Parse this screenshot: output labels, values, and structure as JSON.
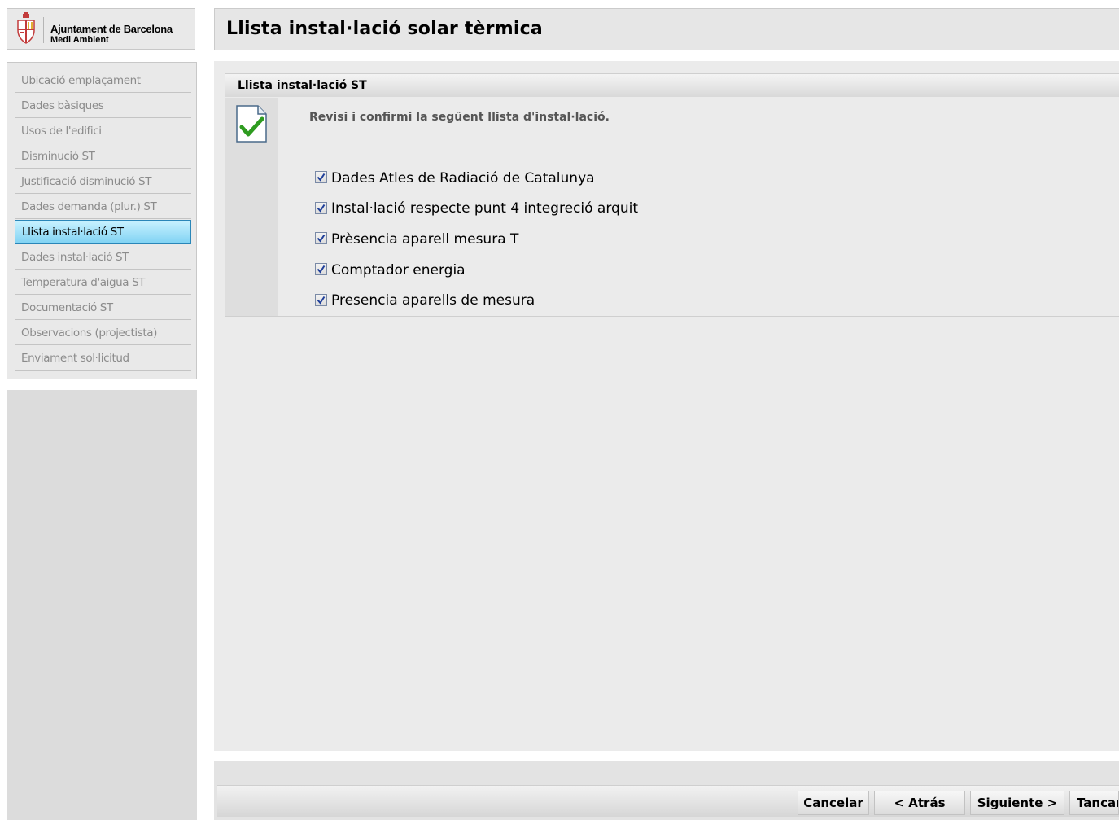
{
  "logo": {
    "title": "Ajuntament de Barcelona",
    "subtitle": "Medi Ambient"
  },
  "page_title": "Llista instal·lació solar tèrmica",
  "nav": [
    {
      "label": "Ubicació emplaçament"
    },
    {
      "label": "Dades bàsiques"
    },
    {
      "label": "Usos de l'edifici"
    },
    {
      "label": "Disminució ST"
    },
    {
      "label": "Justificació disminució ST"
    },
    {
      "label": "Dades demanda (plur.) ST"
    },
    {
      "label": "Llista instal·lació ST"
    },
    {
      "label": "Dades instal·lació ST"
    },
    {
      "label": "Temperatura d'aigua ST"
    },
    {
      "label": "Documentació ST"
    },
    {
      "label": "Observacions (projectista)"
    },
    {
      "label": "Enviament sol·licitud"
    }
  ],
  "active_nav_index": 6,
  "panel": {
    "header": "Llista instal·lació ST",
    "intro": "Revisi i confirmi la següent llista d'instal·lació.",
    "items": [
      {
        "label": "Dades Atles de Radiació de Catalunya",
        "checked": true
      },
      {
        "label": "Instal·lació respecte punt 4 integreció arquit",
        "checked": true
      },
      {
        "label": "Prèsencia aparell mesura T",
        "checked": true
      },
      {
        "label": "Comptador energia",
        "checked": true
      },
      {
        "label": "Presencia aparells de mesura",
        "checked": true
      }
    ]
  },
  "buttons": {
    "cancel": "Cancelar",
    "back": "< Atrás",
    "next": "Siguiente >",
    "close": "Tancar"
  },
  "icons": {
    "logo": "barcelona-coat-of-arms-icon",
    "document": "document-check-icon",
    "checkbox": "checkbox-checked-icon"
  },
  "colors": {
    "active_nav": "#7fd2f3",
    "check_green": "#2e9b1f"
  }
}
